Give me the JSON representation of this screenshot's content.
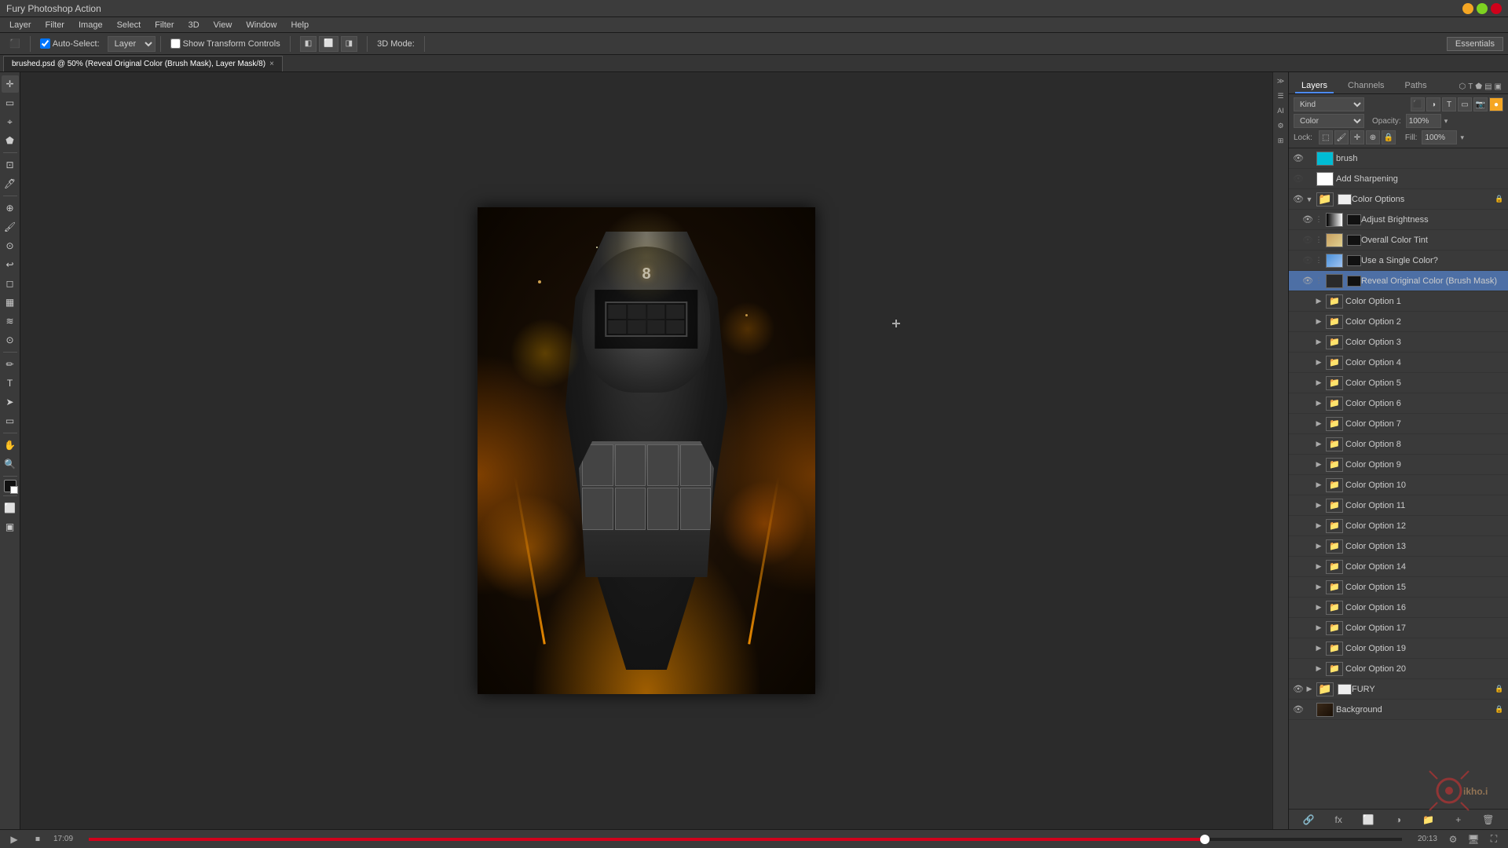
{
  "app": {
    "title": "Fury Photoshop Action",
    "essentials_label": "Essentials"
  },
  "titlebar": {
    "title": "Fury Photoshop Action"
  },
  "menubar": {
    "items": [
      "Layer",
      "Filter",
      "Image",
      "Select",
      "Filter",
      "3D",
      "View",
      "Window",
      "Help"
    ]
  },
  "toolbar": {
    "auto_select_label": "Auto-Select:",
    "layer_label": "Layer",
    "show_transform_label": "Show Transform Controls",
    "mode_label": "3D Mode:"
  },
  "tab": {
    "filename": "brushed.psd @ 50% (Reveal Original Color (Brush Mask), Layer Mask/8)",
    "close": "×"
  },
  "layers_panel": {
    "tabs": [
      "Layers",
      "Channels",
      "Paths"
    ],
    "active_tab": "Layers",
    "kind_label": "Kind",
    "blend_mode": "Color",
    "opacity_label": "Opacity:",
    "opacity_value": "100%",
    "fill_label": "Fill:",
    "fill_value": "100%",
    "lock_label": "Lock:"
  },
  "layers": [
    {
      "name": "brush",
      "visible": true,
      "type": "layer",
      "thumb": "cyan",
      "indent": 0,
      "locked": false,
      "expand": false
    },
    {
      "name": "Add Sharpening",
      "visible": false,
      "type": "layer",
      "thumb": "white",
      "indent": 0,
      "locked": false,
      "expand": false
    },
    {
      "name": "Color Options",
      "visible": true,
      "type": "group",
      "thumb": "folder",
      "indent": 0,
      "locked": false,
      "expand": true
    },
    {
      "name": "Adjust Brightness",
      "visible": true,
      "type": "adjustment",
      "thumb": "brightness",
      "indent": 1,
      "locked": false,
      "expand": false
    },
    {
      "name": "Overall Color Tint",
      "visible": false,
      "type": "adjustment",
      "thumb": "color-tint",
      "indent": 1,
      "locked": false,
      "expand": false
    },
    {
      "name": "Use a Single Color?",
      "visible": false,
      "type": "layer",
      "thumb": "blue-grad",
      "indent": 1,
      "locked": false,
      "expand": false
    },
    {
      "name": "Reveal Original Color (Brush Mask)",
      "visible": true,
      "type": "layer",
      "thumb": "dark-person",
      "indent": 1,
      "locked": false,
      "expand": false,
      "selected": true
    },
    {
      "name": "Color Option 1",
      "visible": true,
      "type": "group",
      "thumb": "folder",
      "indent": 1,
      "locked": false,
      "expand": false
    },
    {
      "name": "Color Option 2",
      "visible": true,
      "type": "group",
      "thumb": "folder",
      "indent": 1,
      "locked": false,
      "expand": false
    },
    {
      "name": "Color Option 3",
      "visible": true,
      "type": "group",
      "thumb": "folder",
      "indent": 1,
      "locked": false,
      "expand": false
    },
    {
      "name": "Color Option 4",
      "visible": true,
      "type": "group",
      "thumb": "folder",
      "indent": 1,
      "locked": false,
      "expand": false
    },
    {
      "name": "Color Option 5",
      "visible": true,
      "type": "group",
      "thumb": "folder",
      "indent": 1,
      "locked": false,
      "expand": false
    },
    {
      "name": "Color Option 6",
      "visible": true,
      "type": "group",
      "thumb": "folder",
      "indent": 1,
      "locked": false,
      "expand": false
    },
    {
      "name": "Color Option 7",
      "visible": true,
      "type": "group",
      "thumb": "folder",
      "indent": 1,
      "locked": false,
      "expand": false
    },
    {
      "name": "Color Option 8",
      "visible": true,
      "type": "group",
      "thumb": "folder",
      "indent": 1,
      "locked": false,
      "expand": false
    },
    {
      "name": "Color Option 9",
      "visible": true,
      "type": "group",
      "thumb": "folder",
      "indent": 1,
      "locked": false,
      "expand": false
    },
    {
      "name": "Color Option 10",
      "visible": true,
      "type": "group",
      "thumb": "folder",
      "indent": 1,
      "locked": false,
      "expand": false
    },
    {
      "name": "Color Option 11",
      "visible": true,
      "type": "group",
      "thumb": "folder",
      "indent": 1,
      "locked": false,
      "expand": false
    },
    {
      "name": "Color Option 12",
      "visible": true,
      "type": "group",
      "thumb": "folder",
      "indent": 1,
      "locked": false,
      "expand": false
    },
    {
      "name": "Color Option 13",
      "visible": true,
      "type": "group",
      "thumb": "folder",
      "indent": 1,
      "locked": false,
      "expand": false
    },
    {
      "name": "Color Option 14",
      "visible": true,
      "type": "group",
      "thumb": "folder",
      "indent": 1,
      "locked": false,
      "expand": false
    },
    {
      "name": "Color Option 15",
      "visible": true,
      "type": "group",
      "thumb": "folder",
      "indent": 1,
      "locked": false,
      "expand": false
    },
    {
      "name": "Color Option 16",
      "visible": true,
      "type": "group",
      "thumb": "folder",
      "indent": 1,
      "locked": false,
      "expand": false
    },
    {
      "name": "Color Option 17",
      "visible": true,
      "type": "group",
      "thumb": "folder",
      "indent": 1,
      "locked": false,
      "expand": false
    },
    {
      "name": "Color Option 19",
      "visible": true,
      "type": "group",
      "thumb": "folder",
      "indent": 1,
      "locked": false,
      "expand": false
    },
    {
      "name": "Color Option 20",
      "visible": true,
      "type": "group",
      "thumb": "folder",
      "indent": 1,
      "locked": false,
      "expand": false
    },
    {
      "name": "FURY",
      "visible": true,
      "type": "group",
      "thumb": "folder",
      "indent": 0,
      "locked": true,
      "expand": false
    },
    {
      "name": "Background",
      "visible": true,
      "type": "layer",
      "thumb": "dark-person",
      "indent": 0,
      "locked": true,
      "expand": false
    }
  ],
  "statusbar": {
    "time_current": "17:09",
    "time_total": "20:13",
    "progress_pct": 85
  },
  "colors": {
    "accent_blue": "#4d8bf5",
    "selected_layer": "#4d6fa5",
    "bg_dark": "#2b2b2b",
    "panel_bg": "#3a3a3a",
    "toolbar_bg": "#3c3c3c"
  }
}
